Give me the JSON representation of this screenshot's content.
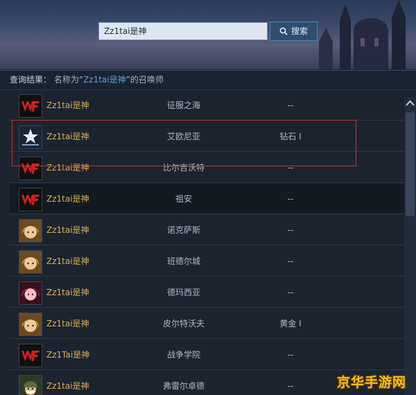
{
  "search": {
    "value": "Zz1tai是神",
    "button_label": "搜索"
  },
  "result_bar": {
    "label": "查询结果：",
    "prefix": "名称为“",
    "query": "Zz1tai是神",
    "suffix": "”的召唤师"
  },
  "rows": [
    {
      "name": "Zz1tai是神",
      "hero": "征服之海",
      "rank": "--",
      "avatar": "wf-logo-icon"
    },
    {
      "name": "Zz1tai是神",
      "hero": "艾欧尼亚",
      "rank": "钻石 I",
      "avatar": "champions-logo-icon"
    },
    {
      "name": "Zz1tai是神",
      "hero": "比尔吉沃特",
      "rank": "--",
      "avatar": "wf-logo-icon"
    },
    {
      "name": "Zz1tai是神",
      "hero": "祖安",
      "rank": "--",
      "avatar": "wf-logo-icon"
    },
    {
      "name": "Zz1tai是神",
      "hero": "诺克萨斯",
      "rank": "--",
      "avatar": "blonde-champion-icon"
    },
    {
      "name": "Zz1tai是神",
      "hero": "班德尔城",
      "rank": "--",
      "avatar": "blonde-champion-icon"
    },
    {
      "name": "Zz1tai是神",
      "hero": "德玛西亚",
      "rank": "--",
      "avatar": "red-hair-champion-icon"
    },
    {
      "name": "Zz1tai是神",
      "hero": "皮尔特沃夫",
      "rank": "黄金 I",
      "avatar": "blonde-champion-icon"
    },
    {
      "name": "Zz1Tai是神",
      "hero": "战争学院",
      "rank": "--",
      "avatar": "wf-logo-icon"
    },
    {
      "name": "Zz1tai是神",
      "hero": "弗雷尔卓德",
      "rank": "--",
      "avatar": "helmet-champion-icon"
    }
  ],
  "watermark": "京华手游网",
  "colors": {
    "name": "#d9b15a",
    "highlight": "#c0392b",
    "accent": "#5da2d8"
  }
}
